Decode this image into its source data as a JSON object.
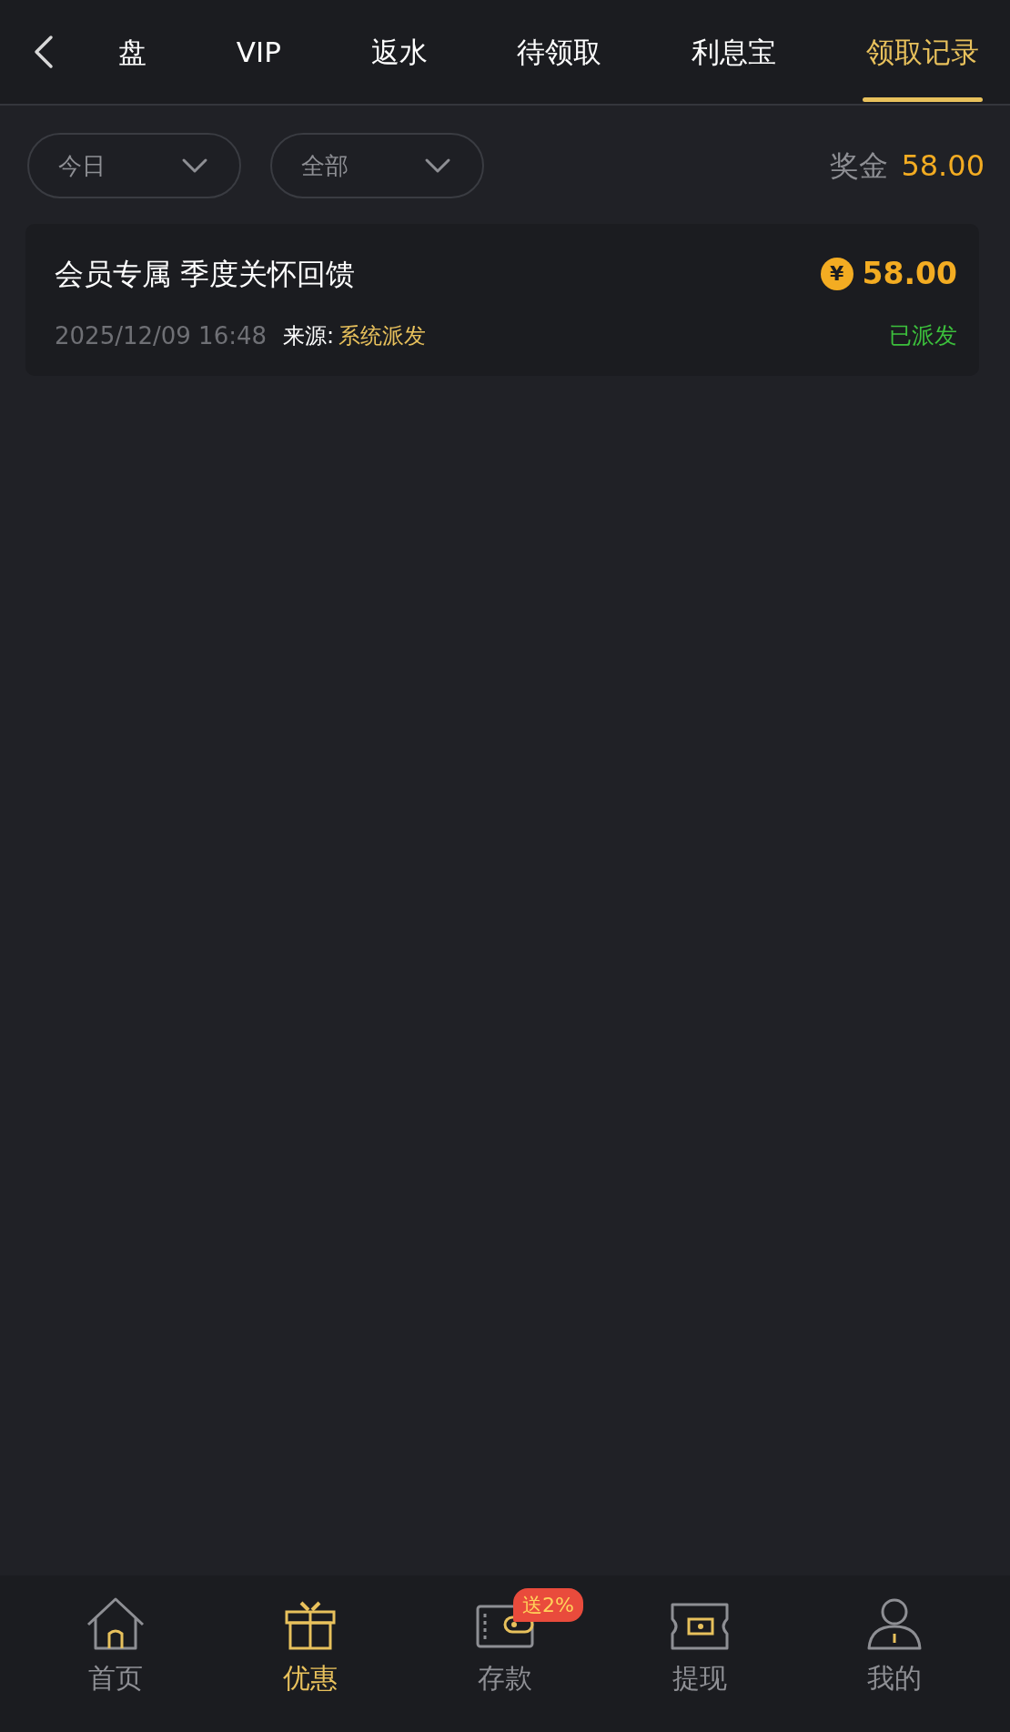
{
  "tabs": [
    {
      "label": "盘",
      "selected": false
    },
    {
      "label": "VIP",
      "selected": false
    },
    {
      "label": "返水",
      "selected": false
    },
    {
      "label": "待领取",
      "selected": false
    },
    {
      "label": "利息宝",
      "selected": false
    },
    {
      "label": "领取记录",
      "selected": true
    }
  ],
  "filters": [
    {
      "value": "今日"
    },
    {
      "value": "全部"
    }
  ],
  "bonus": {
    "label": "奖金",
    "amount": "58.00"
  },
  "records": [
    {
      "title": "会员专属 季度关怀回馈",
      "currency": "¥",
      "amount": "58.00",
      "time": "2025/12/09 16:48",
      "source_label": "来源:",
      "source": "系统派发",
      "status": "已派发"
    }
  ],
  "nav": [
    {
      "kind": "home",
      "label": "首页",
      "selected": false
    },
    {
      "kind": "gift",
      "label": "优惠",
      "selected": true
    },
    {
      "kind": "wallet",
      "label": "存款",
      "selected": false,
      "badge": "送2%"
    },
    {
      "kind": "ticket",
      "label": "提现",
      "selected": false
    },
    {
      "kind": "user",
      "label": "我的",
      "selected": false
    }
  ]
}
